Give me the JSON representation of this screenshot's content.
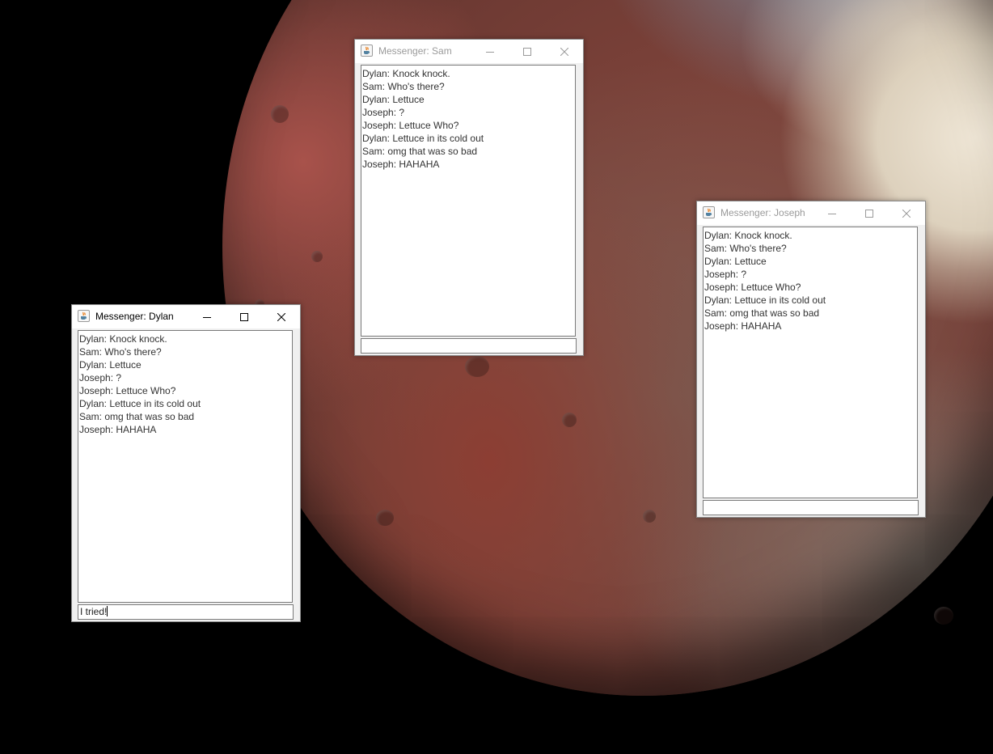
{
  "windows": [
    {
      "id": "sam",
      "title": "Messenger: Sam",
      "active": false,
      "messages": [
        "Dylan: Knock knock.",
        "Sam: Who's there?",
        "Dylan: Lettuce",
        "Joseph: ?",
        "Joseph: Lettuce Who?",
        "Dylan: Lettuce in its cold out",
        "Sam: omg that was so bad",
        "Joseph: HAHAHA"
      ],
      "input_value": ""
    },
    {
      "id": "joseph",
      "title": "Messenger: Joseph",
      "active": false,
      "messages": [
        "Dylan: Knock knock.",
        "Sam: Who's there?",
        "Dylan: Lettuce",
        "Joseph: ?",
        "Joseph: Lettuce Who?",
        "Dylan: Lettuce in its cold out",
        "Sam: omg that was so bad",
        "Joseph: HAHAHA"
      ],
      "input_value": ""
    },
    {
      "id": "dylan",
      "title": "Messenger: Dylan",
      "active": true,
      "messages": [
        "Dylan: Knock knock.",
        "Sam: Who's there?",
        "Dylan: Lettuce",
        "Joseph: ?",
        "Joseph: Lettuce Who?",
        "Dylan: Lettuce in its cold out",
        "Sam: omg that was so bad",
        "Joseph: HAHAHA"
      ],
      "input_value": "I tried!"
    }
  ],
  "icons": {
    "app": "java-cup-icon",
    "minimize": "minimize-icon",
    "maximize": "maximize-icon",
    "close": "close-icon"
  }
}
